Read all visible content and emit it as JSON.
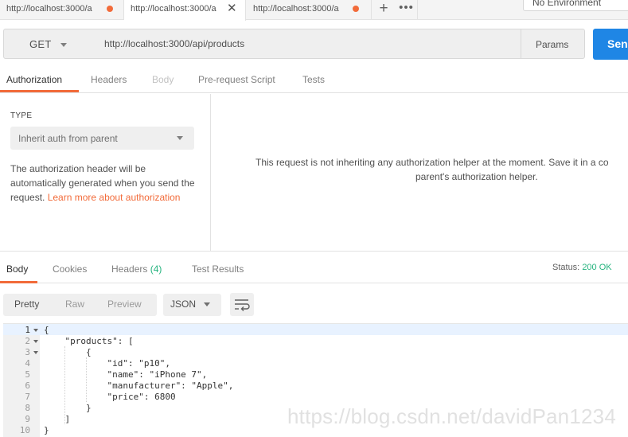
{
  "tabs": [
    {
      "title": "http://localhost:3000/a",
      "unsaved": true
    },
    {
      "title": "http://localhost:3000/a",
      "active": true,
      "close": "✕"
    },
    {
      "title": "http://localhost:3000/a",
      "unsaved": true
    }
  ],
  "tab_actions": {
    "new_tab": "+",
    "more": "•••"
  },
  "environment": {
    "selected": "No Environment"
  },
  "request": {
    "method": "GET",
    "url": "http://localhost:3000/api/products",
    "params_label": "Params",
    "send_label": "Send"
  },
  "request_tabs": [
    "Authorization",
    "Headers",
    "Body",
    "Pre-request Script",
    "Tests"
  ],
  "auth": {
    "type_label": "TYPE",
    "type_value": "Inherit auth from parent",
    "description": "The authorization header will be automatically generated when you send the request.",
    "learn_more": "Learn more about authorization",
    "message_line1": "This request is not inheriting any authorization helper at the moment. Save it in a co",
    "message_line2": "parent's authorization helper."
  },
  "response_tabs": {
    "body": "Body",
    "cookies": "Cookies",
    "headers": "Headers",
    "headers_count": "(4)",
    "test_results": "Test Results"
  },
  "status": {
    "label": "Status:",
    "value": "200 OK"
  },
  "format": {
    "modes": [
      "Pretty",
      "Raw",
      "Preview"
    ],
    "language": "JSON"
  },
  "code_lines": [
    "{",
    "    \"products\": [",
    "        {",
    "            \"id\": \"p10\",",
    "            \"name\": \"iPhone 7\",",
    "            \"manufacturer\": \"Apple\",",
    "            \"price\": 6800",
    "        }",
    "    ]",
    "}"
  ],
  "line_numbers": [
    "1",
    "2",
    "3",
    "4",
    "5",
    "6",
    "7",
    "8",
    "9",
    "10"
  ],
  "watermark": "https://blog.csdn.net/davidPan1234",
  "colors": {
    "accent": "#f26b3a",
    "send": "#1f86e5",
    "success": "#26b47f",
    "dirty_dot": "#f26b3a"
  }
}
